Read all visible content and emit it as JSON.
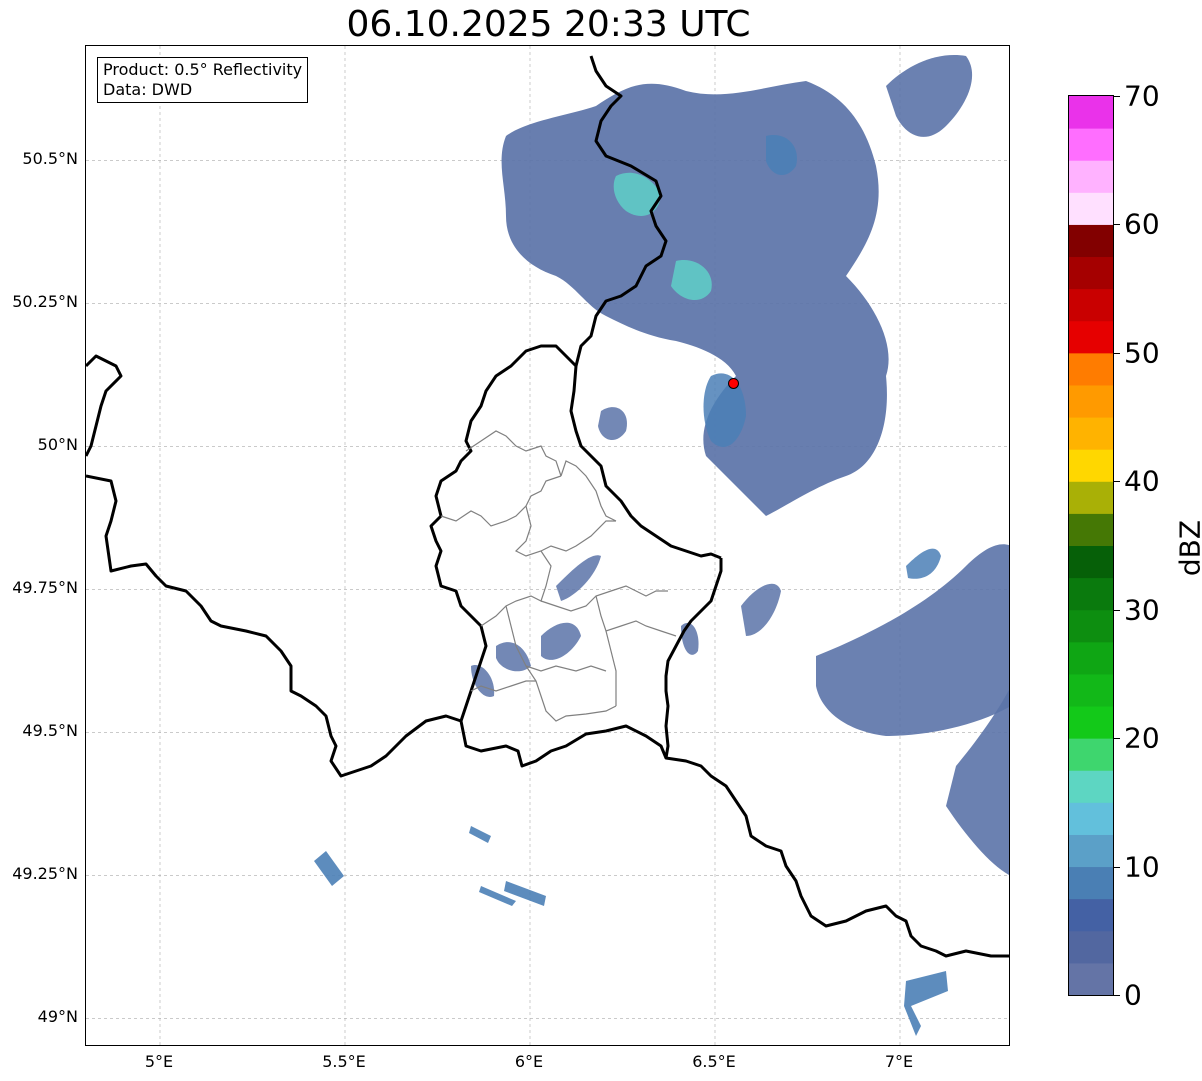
{
  "title": "06.10.2025 20:33 UTC",
  "info": {
    "product": "Product: 0.5° Reflectivity",
    "data_source": "Data: DWD"
  },
  "map": {
    "lon_range": [
      4.8,
      7.3
    ],
    "lat_range": [
      48.95,
      50.7
    ],
    "lat_ticks": [
      {
        "value": 50.5,
        "label": "50.5°N"
      },
      {
        "value": 50.25,
        "label": "50.25°N"
      },
      {
        "value": 50.0,
        "label": "50°N"
      },
      {
        "value": 49.75,
        "label": "49.75°N"
      },
      {
        "value": 49.5,
        "label": "49.5°N"
      },
      {
        "value": 49.25,
        "label": "49.25°N"
      },
      {
        "value": 49.0,
        "label": "49°N"
      }
    ],
    "lon_ticks": [
      {
        "value": 5.0,
        "label": "5°E"
      },
      {
        "value": 5.5,
        "label": "5.5°E"
      },
      {
        "value": 6.0,
        "label": "6°E"
      },
      {
        "value": 6.5,
        "label": "6.5°E"
      },
      {
        "value": 7.0,
        "label": "7°E"
      }
    ],
    "radar_site": {
      "lon": 6.55,
      "lat": 50.11,
      "color": "#ff0000"
    },
    "precip_color_low": "#5b73a8",
    "precip_color_mid": "#4b7fb6",
    "precip_color_high": "#5fcfc8"
  },
  "colorbar": {
    "unit": "dBZ",
    "range": [
      0,
      70
    ],
    "tick_labels": [
      "0",
      "10",
      "20",
      "30",
      "40",
      "50",
      "60",
      "70"
    ],
    "colors": [
      "#6474a6",
      "#5267a0",
      "#4461a4",
      "#4a7fb4",
      "#5ba0c8",
      "#62c0dc",
      "#5dd6c2",
      "#3ed66e",
      "#13c919",
      "#12b818",
      "#0fa614",
      "#0d8e10",
      "#0a7a0d",
      "#066008",
      "#457805",
      "#a9b006",
      "#ffd700",
      "#ffb300",
      "#ff9a00",
      "#ff7c00",
      "#e60000",
      "#c90000",
      "#a50000",
      "#820000",
      "#ffe0ff",
      "#ffb2ff",
      "#ff6eff",
      "#ea32ea"
    ]
  }
}
